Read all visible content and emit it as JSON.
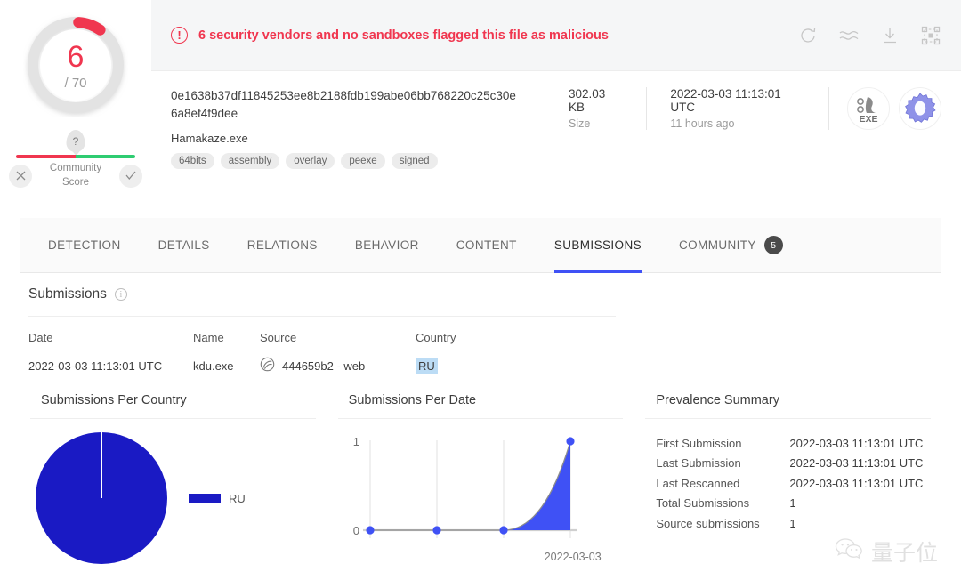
{
  "detection": {
    "score": "6",
    "total": "/ 70",
    "ring_color": "#f0364f",
    "track_color": "#e0e0e0"
  },
  "community_score": {
    "marker": "?",
    "label_line1": "Community",
    "label_line2": "Score",
    "negative_icon": "close-icon",
    "positive_icon": "check-icon",
    "bar_negative_color": "#f0364f",
    "bar_positive_color": "#2ecc71"
  },
  "alert": {
    "icon": "exclamation-circle-icon",
    "text": "6 security vendors and no sandboxes flagged this file as malicious",
    "color": "#f0364f",
    "actions": [
      {
        "name": "reanalyze-icon",
        "title": "Reanalyze"
      },
      {
        "name": "similar-icon",
        "title": "Similar"
      },
      {
        "name": "download-icon",
        "title": "Download"
      },
      {
        "name": "graph-icon",
        "title": "Graph"
      }
    ]
  },
  "file": {
    "hash": "0e1638b37df11845253ee8b2188fdb199abe06bb768220c25c30e6a8ef4f9dee",
    "name": "Hamakaze.exe",
    "tags": [
      "64bits",
      "assembly",
      "overlay",
      "peexe",
      "signed"
    ],
    "size_value": "302.03 KB",
    "size_label": "Size",
    "date_value": "2022-03-03 11:13:01 UTC",
    "date_label": "11 hours ago",
    "type_icon_label": "EXE",
    "type_icon_name": "exe-file-icon",
    "second_icon_name": "gear-icon"
  },
  "tabs": [
    {
      "label": "DETECTION",
      "active": false
    },
    {
      "label": "DETAILS",
      "active": false
    },
    {
      "label": "RELATIONS",
      "active": false
    },
    {
      "label": "BEHAVIOR",
      "active": false
    },
    {
      "label": "CONTENT",
      "active": false
    },
    {
      "label": "SUBMISSIONS",
      "active": true
    },
    {
      "label": "COMMUNITY",
      "active": false,
      "badge": "5"
    }
  ],
  "submissions": {
    "section_title": "Submissions",
    "info_icon": "info-icon",
    "columns": [
      "Date",
      "Name",
      "Source",
      "Country"
    ],
    "rows": [
      {
        "date": "2022-03-03 11:13:01 UTC",
        "name": "kdu.exe",
        "source_icon": "source-globe-icon",
        "source": "444659b2 - web",
        "country": "RU",
        "country_highlighted": true
      }
    ]
  },
  "prevalence": {
    "title": "Prevalence Summary",
    "rows": [
      {
        "key": "First Submission",
        "value": "2022-03-03 11:13:01 UTC"
      },
      {
        "key": "Last Submission",
        "value": "2022-03-03 11:13:01 UTC"
      },
      {
        "key": "Last Rescanned",
        "value": "2022-03-03 11:13:01 UTC"
      },
      {
        "key": "Total Submissions",
        "value": "1"
      },
      {
        "key": "Source submissions",
        "value": "1"
      }
    ]
  },
  "watermark": {
    "text": "量子位",
    "icon": "wechat-icon"
  },
  "chart_data": [
    {
      "type": "pie",
      "title": "Submissions Per Country",
      "categories": [
        "RU"
      ],
      "values": [
        1
      ],
      "percentages": [
        100
      ],
      "colors": [
        "#1a1ac4"
      ],
      "legend": [
        "RU"
      ],
      "legend_position": "right"
    },
    {
      "type": "area",
      "title": "Submissions Per Date",
      "x": [
        "",
        "",
        "",
        "2022-03-03"
      ],
      "values": [
        0,
        0,
        0,
        1
      ],
      "ylim": [
        0,
        1
      ],
      "yticks": [
        "0",
        "1"
      ],
      "xticks": [
        "2022-03-03"
      ],
      "xlabel": "",
      "ylabel": "",
      "grid": true,
      "line_color": "#3f51f5",
      "fill_color": "#3f51f5",
      "point_color": "#3f51f5"
    }
  ]
}
